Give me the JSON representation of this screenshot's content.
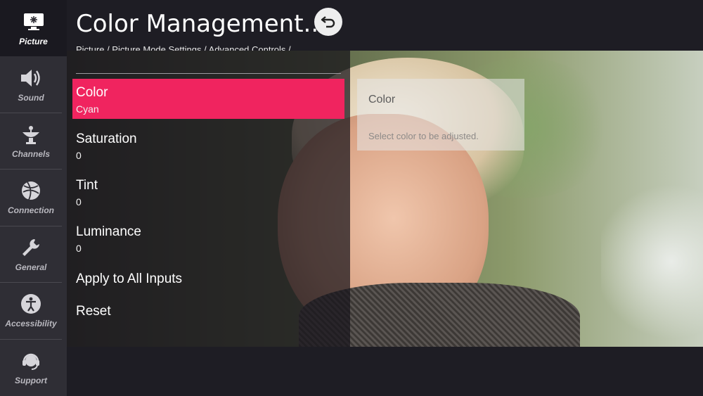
{
  "sidebar": {
    "items": [
      {
        "label": "Picture",
        "icon": "picture-icon"
      },
      {
        "label": "Sound",
        "icon": "speaker-icon"
      },
      {
        "label": "Channels",
        "icon": "satellite-dish-icon"
      },
      {
        "label": "Connection",
        "icon": "globe-icon"
      },
      {
        "label": "General",
        "icon": "wrench-icon"
      },
      {
        "label": "Accessibility",
        "icon": "accessibility-icon"
      },
      {
        "label": "Support",
        "icon": "headset-icon"
      }
    ]
  },
  "header": {
    "title": "Color Management...",
    "breadcrumb": "Picture / Picture Mode Settings / Advanced Controls /",
    "back_icon": "back-arrow-icon"
  },
  "menu": {
    "items": [
      {
        "label": "Color",
        "value": "Cyan"
      },
      {
        "label": "Saturation",
        "value": "0"
      },
      {
        "label": "Tint",
        "value": "0"
      },
      {
        "label": "Luminance",
        "value": "0"
      },
      {
        "label": "Apply to All Inputs"
      },
      {
        "label": "Reset"
      }
    ]
  },
  "info_box": {
    "title": "Color",
    "description": "Select color to be adjusted."
  },
  "colors": {
    "accent": "#f0245f",
    "sidebar_bg": "#2f2e35",
    "background": "#1e1d24"
  }
}
